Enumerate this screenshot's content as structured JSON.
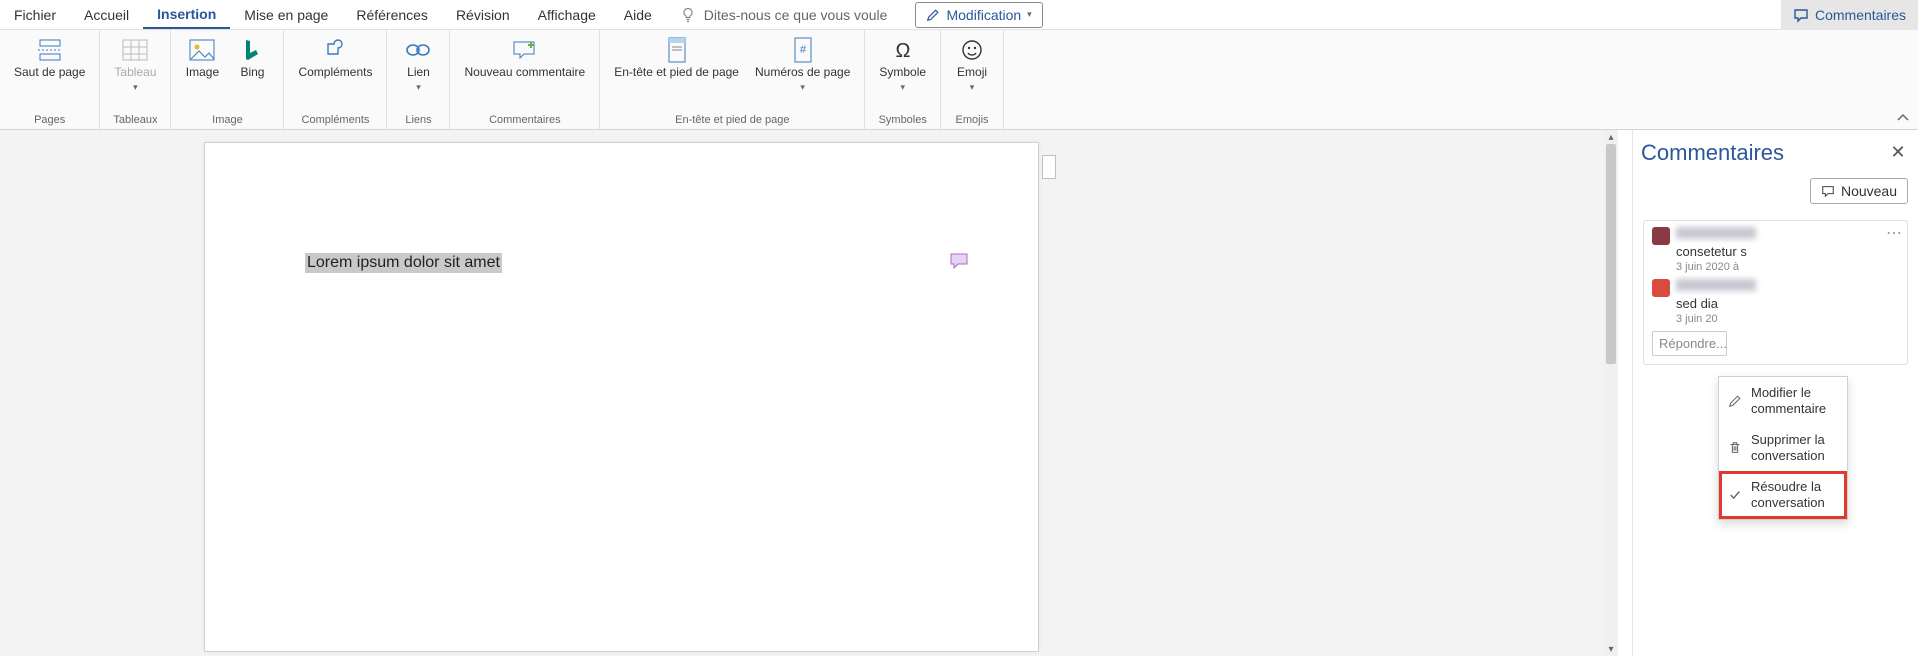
{
  "tabs": {
    "file": "Fichier",
    "home": "Accueil",
    "insert": "Insertion",
    "layout": "Mise en page",
    "references": "Références",
    "review": "Révision",
    "view": "Affichage",
    "help": "Aide",
    "active": "insert"
  },
  "tell_me": "Dites-nous ce que vous voule",
  "editing_button": "Modification",
  "comments_button_top": "Commentaires",
  "ribbon": {
    "pages": {
      "group": "Pages",
      "page_break": "Saut de page"
    },
    "tables": {
      "group": "Tableaux",
      "table": "Tableau"
    },
    "image": {
      "group": "Image",
      "picture": "Image",
      "bing": "Bing"
    },
    "addins": {
      "group": "Compléments",
      "addins": "Compléments"
    },
    "links": {
      "group": "Liens",
      "link": "Lien"
    },
    "comments": {
      "group": "Commentaires",
      "new_comment": "Nouveau commentaire"
    },
    "header_footer": {
      "group": "En-tête et pied de page",
      "hf": "En-tête et pied de page",
      "page_numbers": "Numéros de page"
    },
    "symbols": {
      "group": "Symboles",
      "symbol": "Symbole"
    },
    "emojis": {
      "group": "Emojis",
      "emoji": "Emoji"
    }
  },
  "document": {
    "selected_text": "Lorem ipsum dolor sit amet"
  },
  "comments_pane": {
    "title": "Commentaires",
    "new_label": "Nouveau",
    "reply_placeholder": "Répondre...",
    "thread": [
      {
        "text_preview": "consetetur s",
        "date": "3 juin 2020 à"
      },
      {
        "text_preview": "sed dia",
        "date": "3 juin 20"
      }
    ]
  },
  "context_menu": {
    "edit": "Modifier le commentaire",
    "delete": "Supprimer la conversation",
    "resolve": "Résoudre la conversation"
  }
}
